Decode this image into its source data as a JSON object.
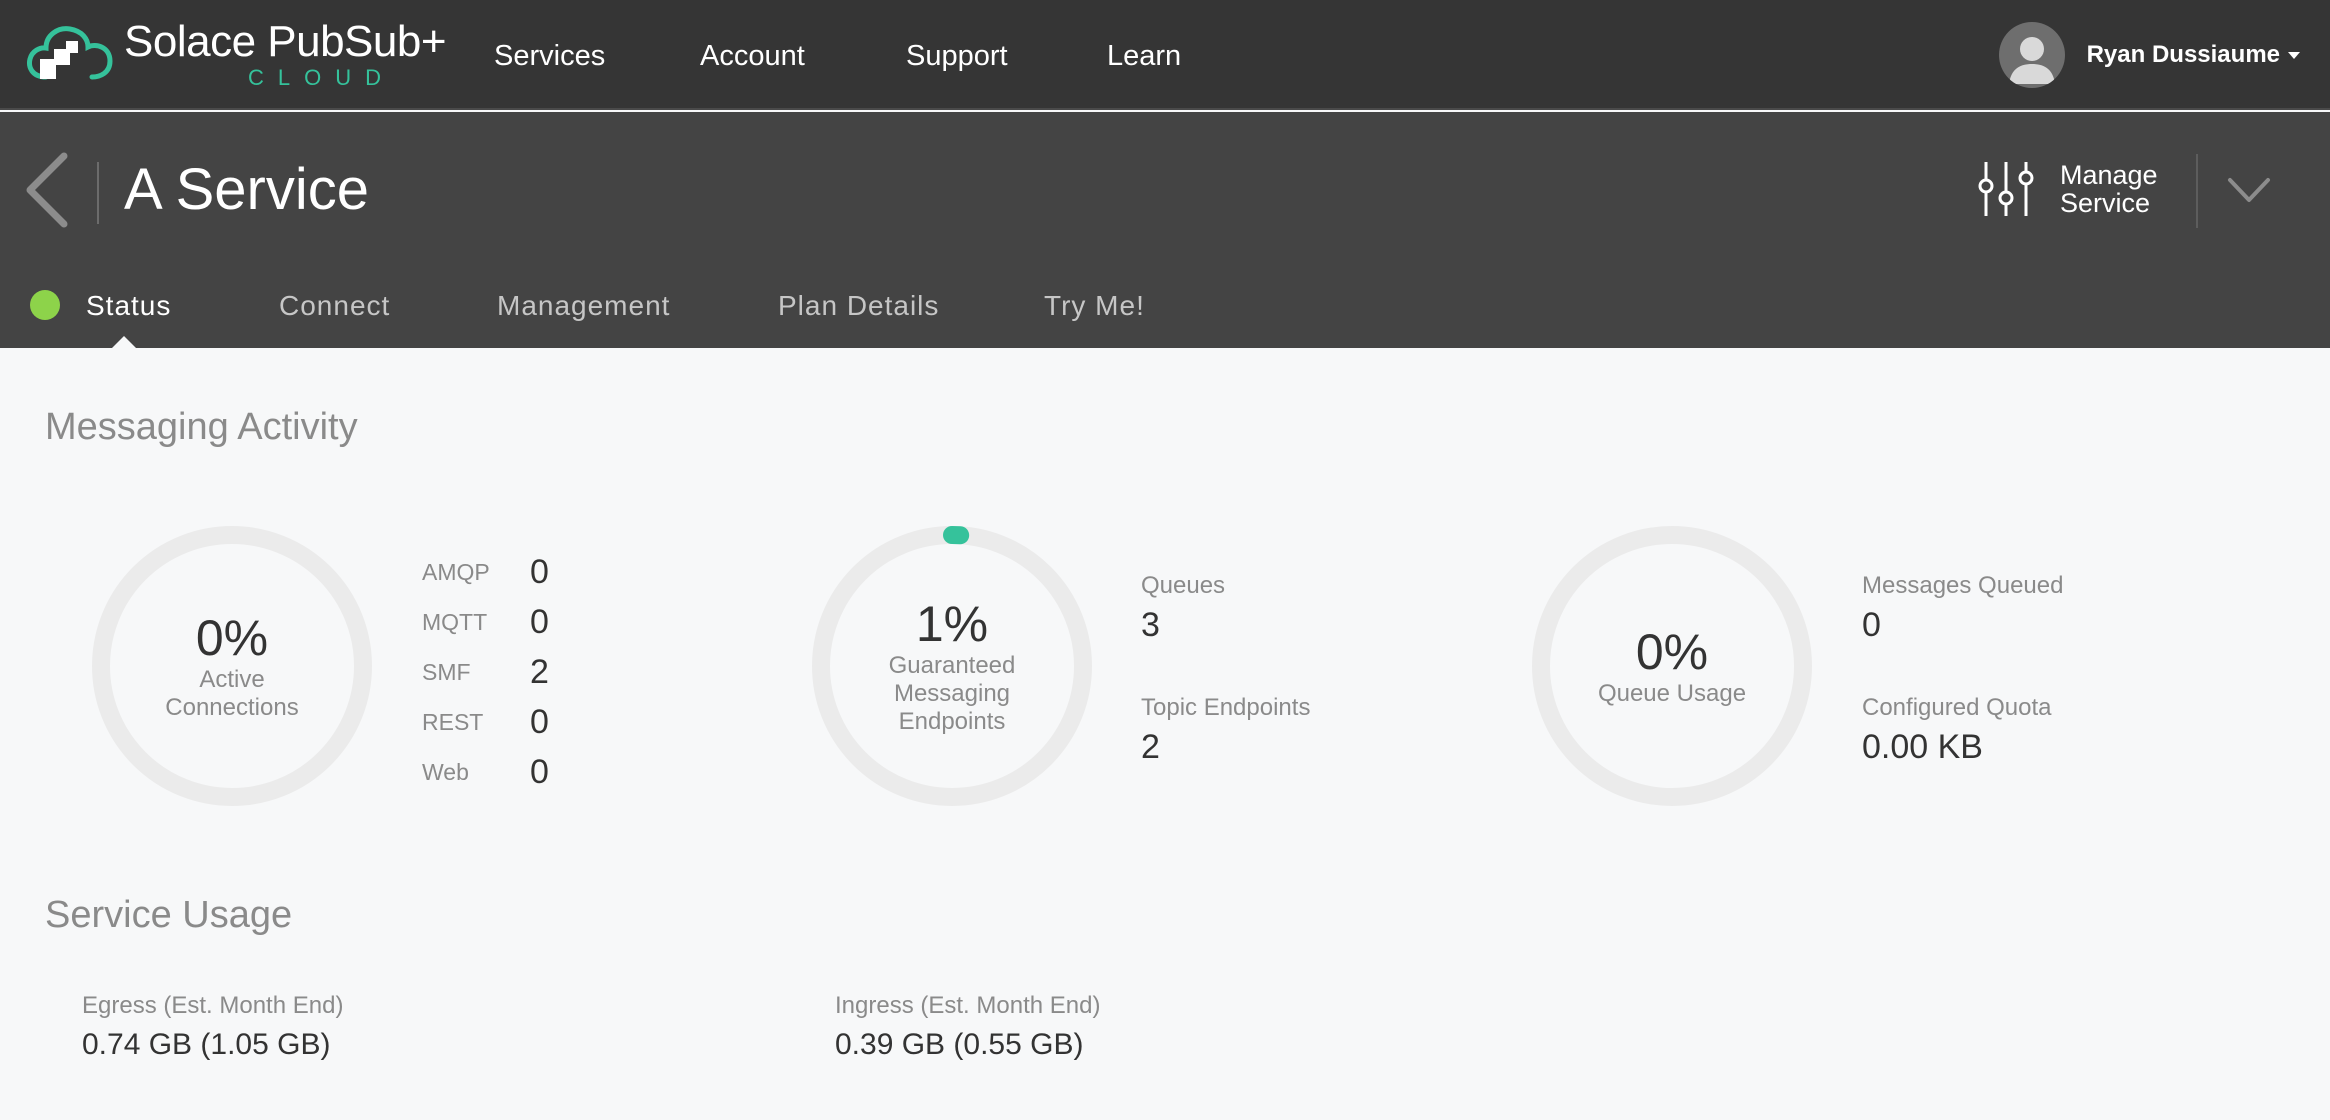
{
  "brand": {
    "name": "Solace PubSub+",
    "sub": "CLOUD"
  },
  "nav": {
    "items": [
      "Services",
      "Account",
      "Support",
      "Learn"
    ]
  },
  "user": {
    "name": "Ryan Dussiaume"
  },
  "service": {
    "title": "A Service",
    "manage_label": "Manage Service"
  },
  "tabs": [
    "Status",
    "Connect",
    "Management",
    "Plan Details",
    "Try Me!"
  ],
  "status_color": "#8dd34a",
  "accent_color": "#35c29b",
  "messaging": {
    "title": "Messaging Activity",
    "connections": {
      "value": "0%",
      "label": "Active Connections",
      "fraction": 0.0,
      "protocols": [
        {
          "name": "AMQP",
          "value": "0"
        },
        {
          "name": "MQTT",
          "value": "0"
        },
        {
          "name": "SMF",
          "value": "2"
        },
        {
          "name": "REST",
          "value": "0"
        },
        {
          "name": "Web",
          "value": "0"
        }
      ]
    },
    "endpoints": {
      "value": "1%",
      "label": "Guaranteed Messaging Endpoints",
      "fraction": 0.01,
      "queues_label": "Queues",
      "queues_value": "3",
      "topics_label": "Topic Endpoints",
      "topics_value": "2"
    },
    "queue": {
      "value": "0%",
      "label": "Queue Usage",
      "fraction": 0.0,
      "msgs_label": "Messages Queued",
      "msgs_value": "0",
      "quota_label": "Configured Quota",
      "quota_value": "0.00 KB"
    }
  },
  "usage": {
    "title": "Service Usage",
    "egress_label": "Egress (Est. Month End)",
    "egress_value": "0.74 GB (1.05 GB)",
    "ingress_label": "Ingress (Est. Month End)",
    "ingress_value": "0.39 GB (0.55 GB)"
  }
}
